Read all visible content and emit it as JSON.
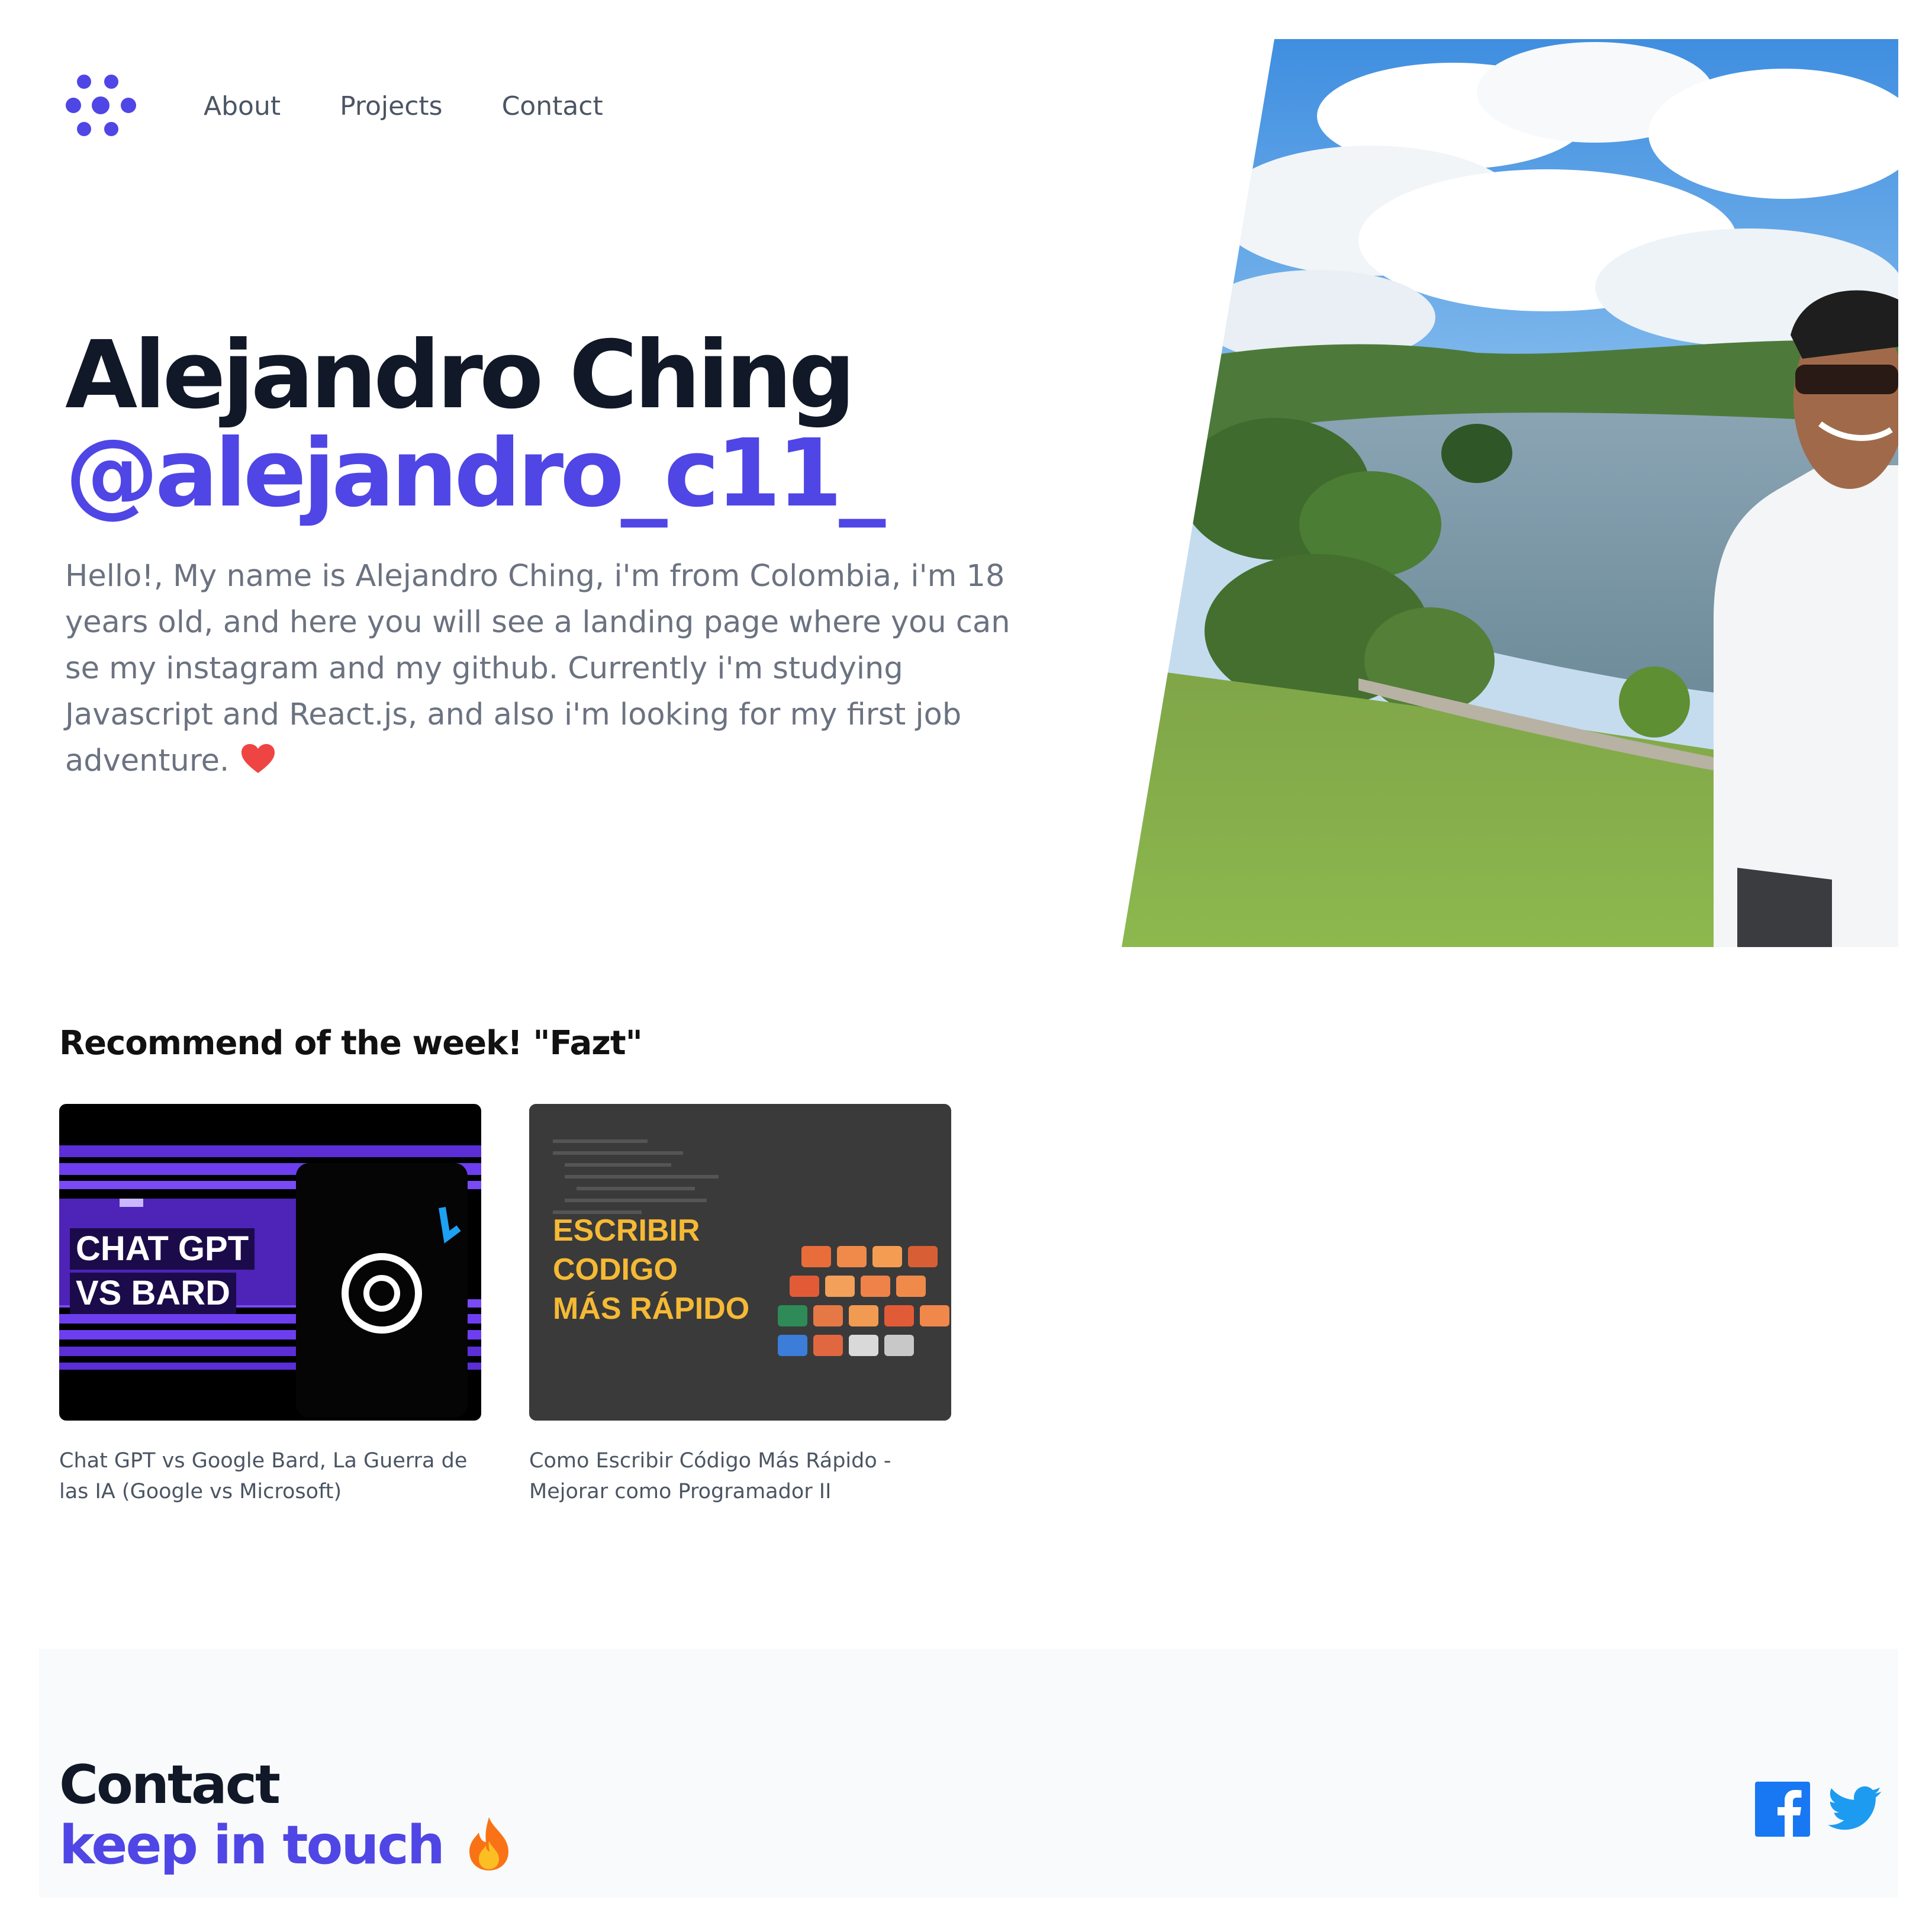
{
  "nav": {
    "logo_icon": "dots-logo-icon",
    "links": [
      "About",
      "Projects",
      "Contact"
    ]
  },
  "hero": {
    "name": "Alejandro Ching",
    "handle": "@alejandro_c11_",
    "description": "Hello!, My name is Alejandro Ching, i'm from Colombia, i'm 18 years old, and here you will see a landing page where you can se my instagram and my github. Currently i'm studying Javascript and React.js, and also i'm looking for my first job adventure.",
    "heart_icon": "heart-icon",
    "photo": "profile-photo-lake"
  },
  "recommend": {
    "title": "Recommend of the week! \"Fazt\"",
    "cards": [
      {
        "thumb_lines": [
          "CHAT GPT",
          "VS BARD"
        ],
        "caption": "Chat GPT vs Google Bard, La Guerra de las IA (Google vs Microsoft)"
      },
      {
        "thumb_lines": [
          "ESCRIBIR",
          "CODIGO",
          "MÁS RÁPIDO"
        ],
        "caption": "Como Escribir Código Más Rápido - Mejorar como Programador II"
      }
    ]
  },
  "contact": {
    "title": "Contact",
    "subtitle": "keep in touch",
    "fire_icon": "fire-icon",
    "social": [
      "facebook-icon",
      "twitter-icon"
    ]
  },
  "colors": {
    "accent": "#4f46e5",
    "heading": "#111827",
    "body_text": "#6b7280",
    "heart": "#ef4444",
    "facebook": "#1877f2",
    "twitter": "#1d9bf0",
    "footer_bg": "#f9fafb"
  }
}
